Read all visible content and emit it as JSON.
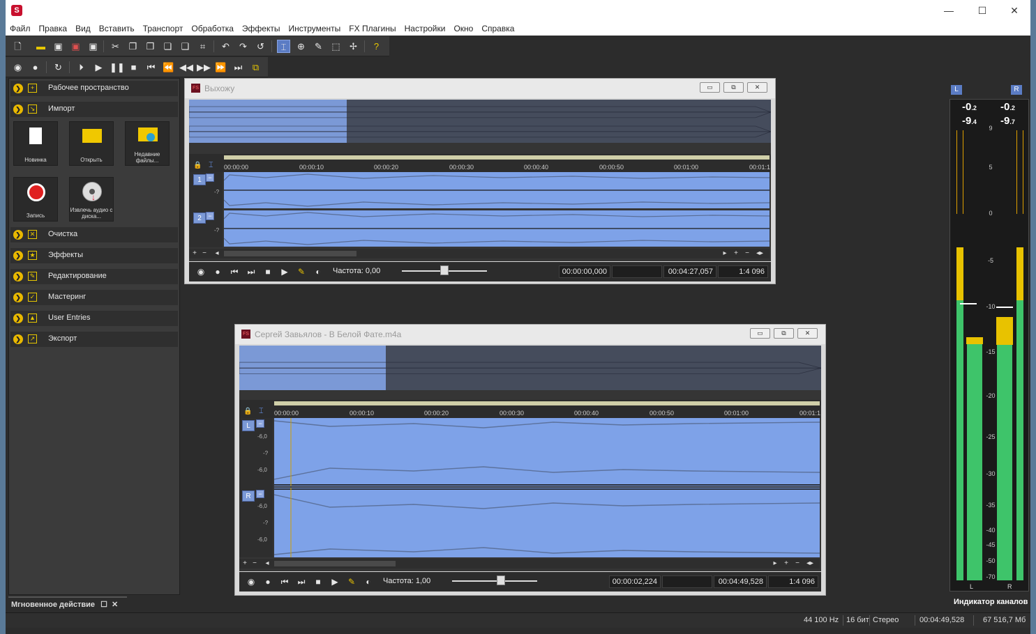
{
  "app": {
    "logo_letter": "S"
  },
  "window_controls": {
    "minimize": "—",
    "maximize": "☐",
    "close": "✕"
  },
  "menu": [
    "Файл",
    "Правка",
    "Вид",
    "Вставить",
    "Транспорт",
    "Обработка",
    "Эффекты",
    "Инструменты",
    "FX Плагины",
    "Настройки",
    "Окно",
    "Справка"
  ],
  "left_panel": {
    "sections": [
      {
        "label": "Рабочее пространство",
        "icon": "workspace-icon"
      },
      {
        "label": "Импорт",
        "icon": "import-icon"
      },
      {
        "label": "Очистка",
        "icon": "cleanup-icon"
      },
      {
        "label": "Эффекты",
        "icon": "effects-icon"
      },
      {
        "label": "Редактирование",
        "icon": "edit-icon"
      },
      {
        "label": "Мастеринг",
        "icon": "mastering-icon"
      },
      {
        "label": "User Entries",
        "icon": "user-entries-icon"
      },
      {
        "label": "Экспорт",
        "icon": "export-icon"
      }
    ],
    "import_tiles": [
      {
        "label": "Новинка",
        "icon": "new-file-icon"
      },
      {
        "label": "Открыть",
        "icon": "open-folder-icon"
      },
      {
        "label": "Недавние файлы...",
        "icon": "recent-files-icon"
      },
      {
        "label": "Запись",
        "icon": "record-icon"
      },
      {
        "label": "Извлечь аудио с диска...",
        "icon": "extract-disc-icon"
      }
    ],
    "quick_action": "Мгновенное действие"
  },
  "windows": [
    {
      "title": "Выхожу",
      "ticks": [
        "00:00:00",
        "00:00:10",
        "00:00:20",
        "00:00:30",
        "00:00:40",
        "00:00:50",
        "00:01:00",
        "00:01:1"
      ],
      "channels": [
        "1",
        "2"
      ],
      "db_labels": [
        "-?",
        "-?"
      ],
      "rate_label": "Частота: 0,00",
      "rate_value": 0.5,
      "position": "00:00:00,000",
      "selection": "",
      "length": "00:04:27,057",
      "zoom": "1:4 096"
    },
    {
      "title": "Сергей Завьялов - В Белой Фате.m4a",
      "ticks": [
        "00:00:00",
        "00:00:10",
        "00:00:20",
        "00:00:30",
        "00:00:40",
        "00:00:50",
        "00:01:00",
        "00:01:1"
      ],
      "channels": [
        "L",
        "R"
      ],
      "db_labels": [
        "-6,0",
        "-?",
        "-6,0",
        "-6,0",
        "-?",
        "-6,0"
      ],
      "rate_label": "Частота: 1,00",
      "rate_value": 0.58,
      "position": "00:00:02,224",
      "selection": "",
      "length": "00:04:49,528",
      "zoom": "1:4 096"
    }
  ],
  "meter": {
    "left_tag": "L",
    "right_tag": "R",
    "left_peak_main": "-0",
    "left_peak_sub": ".2",
    "right_peak_main": "-0",
    "right_peak_sub": ".2",
    "left_rms_main": "-9",
    "left_rms_sub": ".4",
    "right_rms_main": "-9",
    "right_rms_sub": ".7",
    "scale": [
      "9",
      "5",
      "0",
      "-5",
      "-10",
      "-15",
      "-20",
      "-25",
      "-30",
      "-35",
      "-40",
      "-45",
      "-50",
      "-70"
    ],
    "bottom_left": "L",
    "bottom_right": "R",
    "title": "Индикатор каналов"
  },
  "status": {
    "rate": "44 100 Hz",
    "bits": "16 бит",
    "mode": "Стерео",
    "length": "00:04:49,528",
    "size": "67 516,7 Мб"
  }
}
